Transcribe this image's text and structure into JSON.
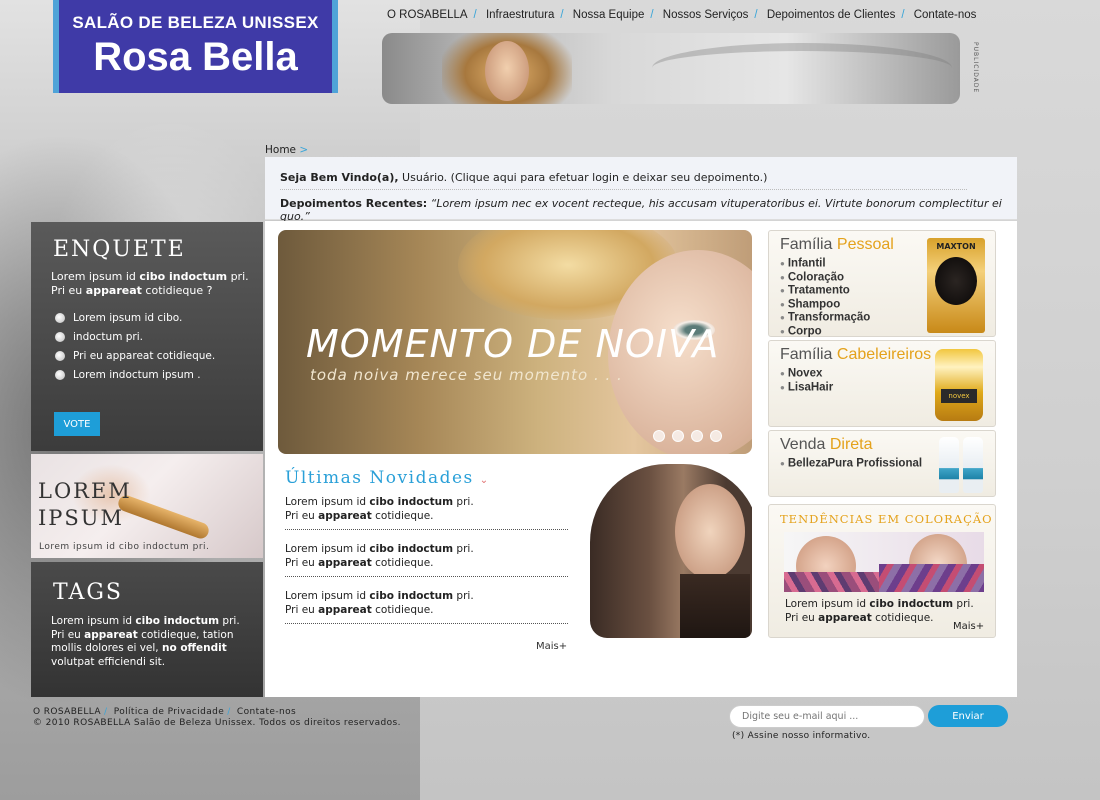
{
  "logo": {
    "subtitle": "SALÃO DE BELEZA UNISSEX",
    "name": "Rosa Bella"
  },
  "nav": [
    {
      "label": "O ROSABELLA"
    },
    {
      "label": "Infraestrutura"
    },
    {
      "label": "Nossa Equipe"
    },
    {
      "label": "Nossos Serviços"
    },
    {
      "label": "Depoimentos de Clientes"
    },
    {
      "label": "Contate-nos"
    }
  ],
  "publicidade": "PUBLICIDADE",
  "breadcrumb": {
    "home": "Home",
    "arrow": ">"
  },
  "welcome": {
    "greeting": "Seja Bem Vindo(a),",
    "user_text": " Usuário. (Clique aqui para efetuar login e deixar seu depoimento.)",
    "recent_label": "Depoimentos Recentes:",
    "recent_quote": " “Lorem ipsum nec ex vocent recteque, his accusam vituperatoribus ei. Virtute bonorum complectitur ei quo.”"
  },
  "enquete": {
    "title": "ENQUETE",
    "question_a": "Lorem ipsum id ",
    "question_b": "cibo indoctum",
    "question_c": " pri.",
    "question_d": "Pri eu ",
    "question_e": "appareat",
    "question_f": " cotidieque ?",
    "options": [
      "Lorem ipsum id cibo.",
      "indoctum pri.",
      "Pri eu appareat cotidieque.",
      "Lorem indoctum ipsum ."
    ],
    "vote_label": "VOTE"
  },
  "lorem_box": {
    "title_1": "LOREM",
    "title_2": "IPSUM",
    "caption": "Lorem ipsum id cibo indoctum pri."
  },
  "tags": {
    "title": "TAGS",
    "t1": "Lorem ipsum id ",
    "t2": "cibo indoctum",
    "t3": " pri. Pri eu ",
    "t4": "appareat",
    "t5": " cotidieque, tation mollis dolores ei vel, ",
    "t6": "no offendit",
    "t7": " volutpat efficiendi sit."
  },
  "hero": {
    "title": "MOMENTO DE NOIVA",
    "subtitle": "toda noiva merece seu momento . . .",
    "slides": 4,
    "active_slide": 1
  },
  "news": {
    "title": "Últimas Novidades",
    "items": [
      {
        "a": "Lorem ipsum id ",
        "b": "cibo indoctum",
        "c": " pri.",
        "d": "Pri eu ",
        "e": "appareat",
        "f": " cotidieque."
      },
      {
        "a": "Lorem ipsum id ",
        "b": "cibo indoctum",
        "c": " pri.",
        "d": "Pri eu ",
        "e": "appareat",
        "f": " cotidieque."
      },
      {
        "a": "Lorem ipsum id ",
        "b": "cibo indoctum",
        "c": " pri.",
        "d": "Pri eu ",
        "e": "appareat",
        "f": " cotidieque."
      }
    ],
    "more": "Mais+"
  },
  "products": {
    "pessoal": {
      "title_a": "Família ",
      "title_b": "Pessoal",
      "items": [
        "Infantil",
        "Coloração",
        "Tratamento",
        "Shampoo",
        "Transformação",
        "Corpo"
      ],
      "brand": "MAXTON"
    },
    "cabeleireiros": {
      "title_a": "Família ",
      "title_b": "Cabeleireiros",
      "items": [
        "Novex",
        "LisaHair"
      ],
      "brand": "novex"
    },
    "venda": {
      "title_a": "Venda ",
      "title_b": "Direta",
      "items": [
        "BellezaPura Profissional"
      ]
    }
  },
  "tendencias": {
    "title": "TENDÊNCIAS EM COLORAÇÃO",
    "a": "Lorem ipsum id ",
    "b": "cibo indoctum",
    "c": " pri.",
    "d": "Pri eu ",
    "e": "appareat",
    "f": " cotidieque.",
    "more": "Mais+"
  },
  "footer": {
    "links": [
      "O ROSABELLA",
      "Política de Privacidade",
      "Contate-nos"
    ],
    "copyright": "© 2010 ROSABELLA Salão de Beleza Unissex. Todos os direitos reservados.",
    "email_placeholder": "Digite seu e-mail aqui ...",
    "send_label": "Enviar",
    "subscribe_note": "(*) Assine nosso informativo."
  },
  "colors": {
    "accent_blue": "#1e9ed8",
    "accent_orange": "#e4a21c",
    "logo_bg": "#3f3aa7"
  }
}
